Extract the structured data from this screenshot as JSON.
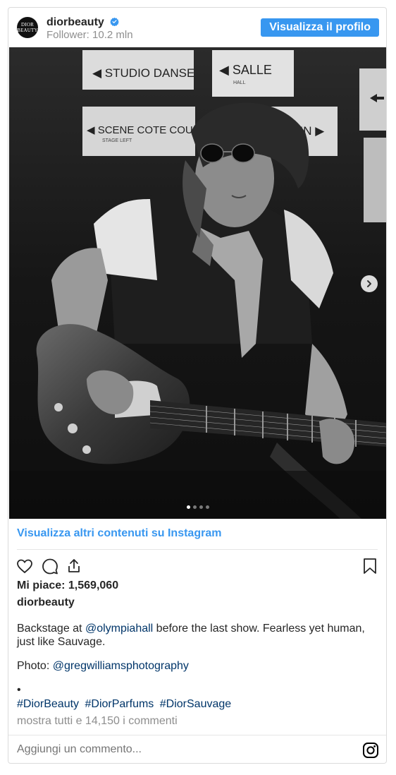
{
  "header": {
    "avatar_text_line1": "DIOR",
    "avatar_text_line2": "BEAUTY",
    "username": "diorbeauty",
    "followers": "Follower: 10.2 mln",
    "profile_button": "Visualizza il profilo"
  },
  "photo": {
    "sign_1": "◀ STUDIO DANSE",
    "sign_2": "◀ SALLE",
    "sign_2_sub": "HALL",
    "sign_3": "◀ SCENE COTE COUR",
    "sign_3_sub": "STAGE LEFT",
    "sign_4": "RDIN ▶",
    "carousel_total": 4,
    "carousel_active": 1
  },
  "more_link": "Visualizza altri contenuti su Instagram",
  "likes": "Mi piace: 1,569,060",
  "caption_user": "diorbeauty",
  "caption": {
    "part1": "Backstage at ",
    "mention1": "@olympiahall",
    "part2": " before the last show. Fearless yet human, just like Sauvage."
  },
  "photo_credit": {
    "label": "Photo: ",
    "mention": "@gregwilliamsphotography"
  },
  "bullet": "•",
  "hashtags": [
    "#DiorBeauty",
    "#DiorParfums",
    "#DiorSauvage"
  ],
  "comments_link": "mostra tutti e 14,150 i commenti",
  "comment_placeholder": "Aggiungi un commento...",
  "colors": {
    "accent": "#3897f0",
    "link": "#003569",
    "muted": "#8e8e8e",
    "text": "#262626"
  },
  "icons": [
    "verified-icon",
    "heart-icon",
    "comment-icon",
    "share-icon",
    "bookmark-icon",
    "chevron-right-icon",
    "instagram-icon"
  ]
}
